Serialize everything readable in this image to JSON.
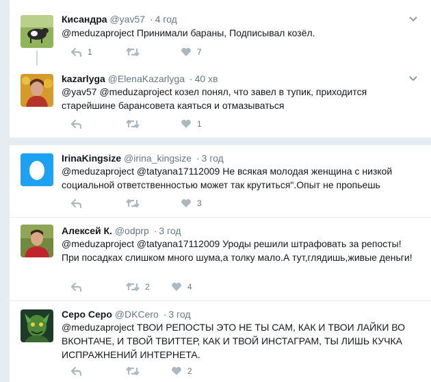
{
  "colors": {
    "background": "#e6ecf0",
    "text": "#14171a",
    "muted": "#657786",
    "icon": "#aab8c2"
  },
  "tweets": [
    {
      "name": "Кисандра",
      "handle": "@yav57",
      "separator": "·",
      "time": "4 год",
      "text": "@meduzaproject Принимали бараны, Подписывал козёл.",
      "reply_count": "1",
      "retweet_count": "",
      "like_count": "7"
    },
    {
      "name": "kazarlyga",
      "handle": "@ElenaKazarlyga",
      "separator": "·",
      "time": "40 хв",
      "text": "@yav57 @meduzaproject козел понял, что завел в тупик, приходится старейшине барансовета каяться и отмазываться",
      "reply_count": "",
      "retweet_count": "",
      "like_count": "1"
    },
    {
      "name": "IrinaKingsize",
      "handle": "@irina_kingsize",
      "separator": "·",
      "time": "3 год",
      "text": "@meduzaproject @tatyana17112009 Не всякая молодая женщина с низкой социальной ответственностью может так крутиться\".Опыт не пропьешь",
      "reply_count": "",
      "retweet_count": "",
      "like_count": "3"
    },
    {
      "name": "Алексей К.",
      "handle": "@odprp",
      "separator": "·",
      "time": "3 год",
      "text": "@meduzaproject @tatyana17112009  Уроды решили штрафовать за репосты! При посадках слишком много шума,а толку мало.А тут,глядишь,живые деньги!",
      "reply_count": "",
      "retweet_count": "2",
      "like_count": "4"
    },
    {
      "name": "Серо Серо",
      "handle": "@DKCero",
      "separator": "·",
      "time": "3 год",
      "text": "@meduzaproject ТВОИ РЕПОСТЫ ЭТО НЕ ТЫ САМ, КАК И ТВОИ ЛАЙКИ ВО ВКОНТАЧЕ, И ТВОЙ ТВИТТЕР, КАК И ТВОЙ ИНСТАГРАМ, ТЫ ЛИШЬ КУЧКА ИСПРАЖНЕНИЙ ИНТЕРНЕТА.",
      "reply_count": "",
      "retweet_count": "",
      "like_count": "2"
    }
  ]
}
